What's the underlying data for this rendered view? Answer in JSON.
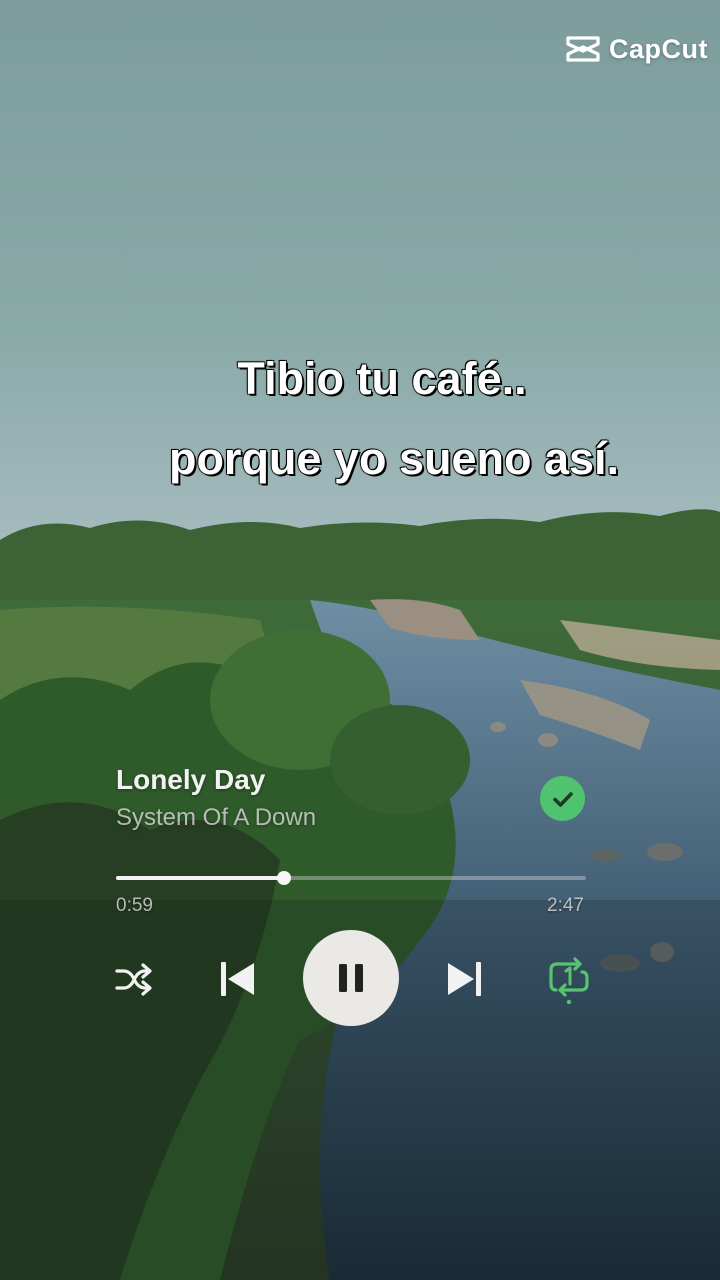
{
  "watermark": {
    "brand": "CapCut",
    "icon": "capcut-logo-icon"
  },
  "lyrics": {
    "line1": "Tibio tu café..",
    "line2": "porque yo sueno así."
  },
  "player": {
    "title": "Lonely Day",
    "artist": "System Of A Down",
    "liked": true,
    "elapsed": "0:59",
    "duration": "2:47",
    "progress_fraction": 0.357,
    "state": "playing",
    "repeat_mode": "repeat-one",
    "colors": {
      "accent": "#4fc36f",
      "play_button_bg": "#eae9e5"
    },
    "icons": {
      "shuffle": "shuffle-icon",
      "previous": "skip-previous-icon",
      "pause": "pause-icon",
      "next": "skip-next-icon",
      "repeat": "repeat-one-icon",
      "liked": "checkmark-icon"
    }
  }
}
